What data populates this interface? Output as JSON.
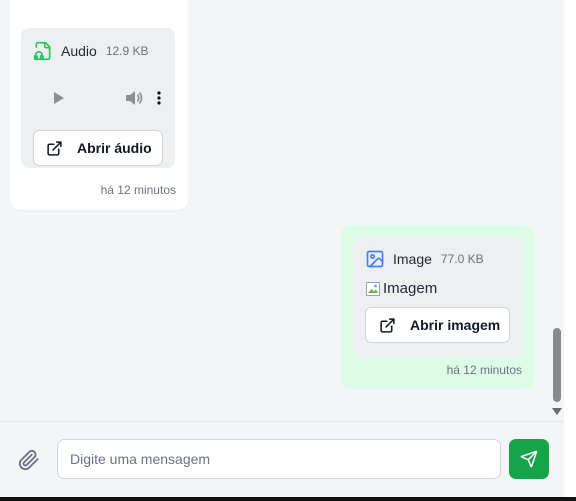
{
  "messages": [
    {
      "direction": "incoming",
      "attachment": {
        "type": "audio",
        "icon": "file-headphones-icon",
        "name": "Audio",
        "size": "12.9 KB",
        "open_label": "Abrir áudio"
      },
      "time": "há 12 minutos"
    },
    {
      "direction": "outgoing",
      "attachment": {
        "type": "image",
        "icon": "image-icon",
        "name": "Image",
        "size": "77.0 KB",
        "alt_text": "Imagem",
        "open_label": "Abrir imagem"
      },
      "time": "há 12 minutos"
    }
  ],
  "composer": {
    "placeholder": "Digite uma mensagem",
    "value": ""
  },
  "colors": {
    "accent": "#16a34a",
    "outgoing_bubble": "#dcfce7",
    "incoming_bubble": "#ffffff",
    "audio_icon": "#22c55e",
    "image_icon": "#3b82f6"
  }
}
